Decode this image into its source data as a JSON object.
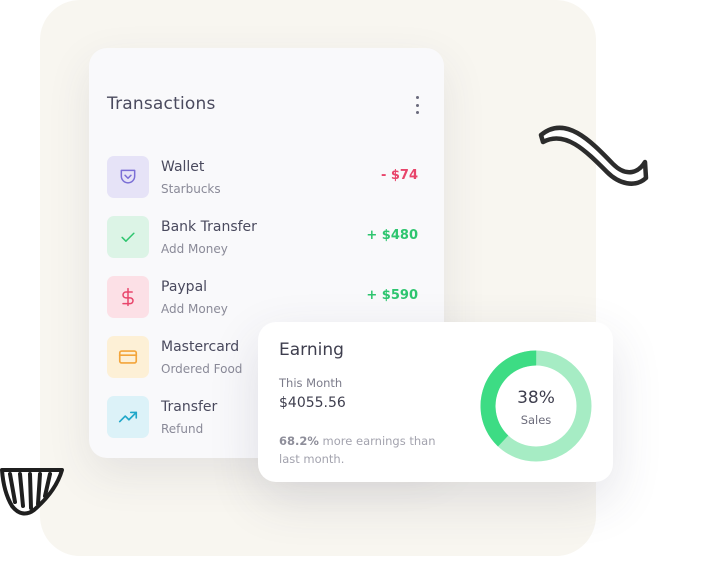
{
  "transactions": {
    "title": "Transactions",
    "items": [
      {
        "name": "Wallet",
        "sub": "Starbucks",
        "amount": "- $74",
        "icon": "wallet-icon",
        "icon_bg": "#e6e3f7",
        "icon_color": "#7b6fd6",
        "amount_color": "#e8456b"
      },
      {
        "name": "Bank Transfer",
        "sub": "Add Money",
        "amount": "+ $480",
        "icon": "check-icon",
        "icon_bg": "#dcf4e6",
        "icon_color": "#2ec56f",
        "amount_color": "#2ec56f"
      },
      {
        "name": "Paypal",
        "sub": "Add Money",
        "amount": "+ $590",
        "icon": "dollar-icon",
        "icon_bg": "#fce0e6",
        "icon_color": "#e8456b",
        "amount_color": "#2ec56f"
      },
      {
        "name": "Mastercard",
        "sub": "Ordered Food",
        "amount": "",
        "icon": "credit-card-icon",
        "icon_bg": "#fdf0d6",
        "icon_color": "#f3a53b",
        "amount_color": "#2ec56f"
      },
      {
        "name": "Transfer",
        "sub": "Refund",
        "amount": "",
        "icon": "trending-up-icon",
        "icon_bg": "#dcf2f8",
        "icon_color": "#1fa7c9",
        "amount_color": "#2ec56f"
      }
    ]
  },
  "earning": {
    "title": "Earning",
    "period": "This Month",
    "amount": "$4055.56",
    "note_highlight": "68.2%",
    "note_rest": " more earnings than last month.",
    "donut_percent": "38%",
    "donut_label": "Sales",
    "donut_value": 0.38,
    "colors": {
      "main": "#3ddc84",
      "rest": "#a6ecc4"
    }
  }
}
